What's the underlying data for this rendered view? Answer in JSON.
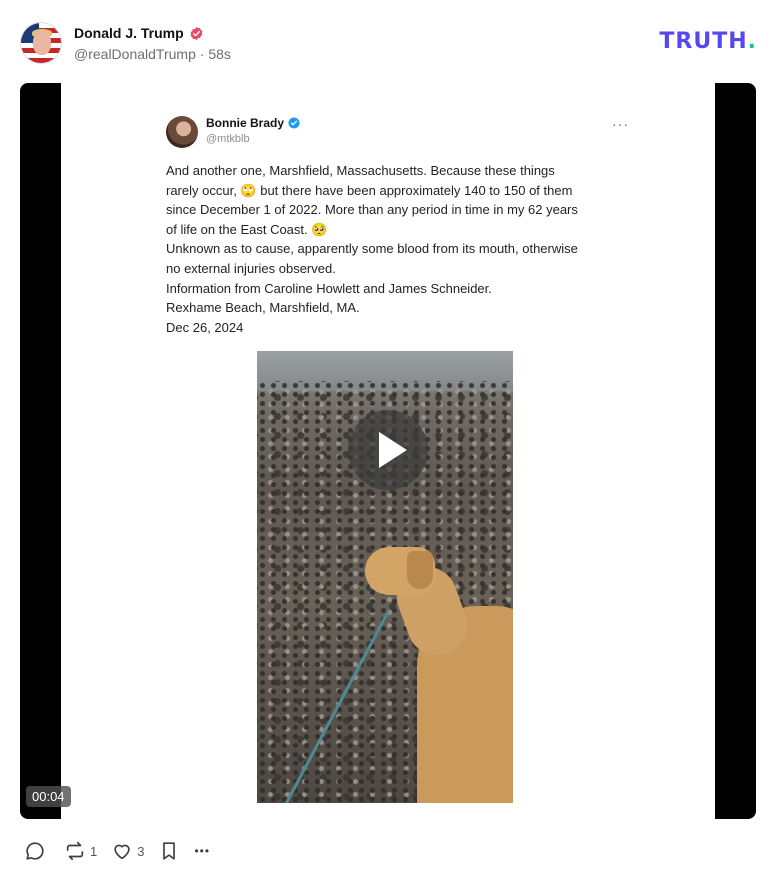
{
  "post": {
    "author_name": "Donald J. Trump",
    "author_handle": "@realDonaldTrump",
    "separator": "·",
    "time_ago": "58s",
    "verified_icon": "verified-badge-icon",
    "brand": {
      "logo_text": "TRUTH",
      "logo_dot": ".",
      "colors": {
        "text": "#5448ee",
        "dot": "#1bc2a8"
      }
    }
  },
  "media": {
    "embedded_tweet": {
      "author_name": "Bonnie Brady",
      "author_handle": "@mtkblb",
      "more_label": "···",
      "lines": [
        "And another one, Marshfield, Massachusetts. Because these things",
        "rarely occur, 🙄 but there have been approximately 140 to 150 of them",
        "since December 1 of 2022. More than any period in time in my 62 years",
        "of life on the East Coast. 🥺",
        "Unknown as to cause, apparently some blood from its mouth, otherwise",
        "no external injuries observed.",
        "Information from Caroline Howlett and James Schneider.",
        "Rexhame Beach, Marshfield, MA.",
        "Dec 26, 2024"
      ]
    },
    "duration": "00:04",
    "play_icon": "play-icon"
  },
  "actions": {
    "reply": {
      "icon": "reply-icon",
      "count": ""
    },
    "repost": {
      "icon": "repost-icon",
      "count": "1"
    },
    "like": {
      "icon": "heart-icon",
      "count": "3"
    },
    "bookmark": {
      "icon": "bookmark-icon",
      "count": ""
    },
    "more": {
      "icon": "more-icon",
      "label": "•••"
    }
  }
}
